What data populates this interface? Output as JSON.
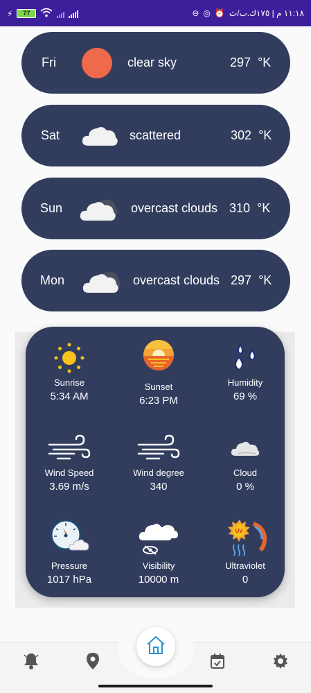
{
  "status_bar": {
    "time_text": "١١:١٨ م | ١٧٥ك.ب/ث",
    "battery": "77"
  },
  "forecast": [
    {
      "day": "Fri",
      "description": "clear sky",
      "temp": "297",
      "unit": "°K",
      "icon": "sun-icon"
    },
    {
      "day": "Sat",
      "description": "scattered",
      "temp": "302",
      "unit": "°K",
      "icon": "cloud-icon"
    },
    {
      "day": "Sun",
      "description": "overcast clouds",
      "temp": "310",
      "unit": "°K",
      "icon": "overcast-cloud-icon"
    },
    {
      "day": "Mon",
      "description": "overcast clouds",
      "temp": "297",
      "unit": "°K",
      "icon": "overcast-cloud-icon"
    }
  ],
  "details": {
    "sunrise": {
      "label": "Sunrise",
      "value": "5:34 AM",
      "icon": "sunrise-icon"
    },
    "sunset": {
      "label": "Sunset",
      "value": "6:23 PM",
      "icon": "sunset-icon"
    },
    "humidity": {
      "label": "Humidity",
      "value": "69 %",
      "icon": "humidity-icon"
    },
    "wind_speed": {
      "label": "Wind Speed",
      "value": "3.69 m/s",
      "icon": "wind-icon"
    },
    "wind_degree": {
      "label": "Wind degree",
      "value": "340",
      "icon": "wind-icon"
    },
    "cloud": {
      "label": "Cloud",
      "value": "0 %",
      "icon": "cloud-icon"
    },
    "pressure": {
      "label": "Pressure",
      "value": "1017 hPa",
      "icon": "pressure-gauge-icon"
    },
    "visibility": {
      "label": "Visibility",
      "value": "10000 m",
      "icon": "visibility-icon"
    },
    "ultraviolet": {
      "label": "Ultraviolet",
      "value": "0",
      "icon": "uv-icon"
    }
  },
  "nav": {
    "items": [
      "notifications-icon",
      "location-icon",
      "home-icon",
      "calendar-icon",
      "settings-icon"
    ],
    "active": "home-icon"
  },
  "colors": {
    "card": "#323d5e",
    "status_bar": "#3d1f9c",
    "sun": "#ef6a4a",
    "home_accent": "#2a8fd6"
  }
}
